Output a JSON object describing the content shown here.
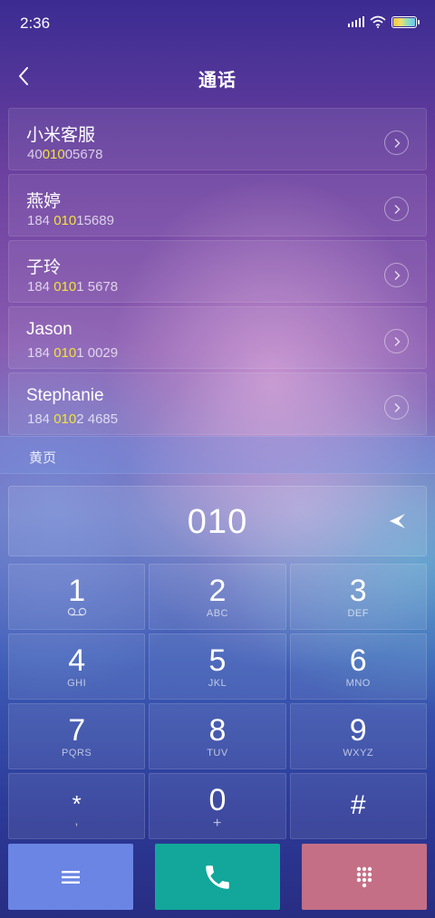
{
  "status_bar": {
    "time": "2:36"
  },
  "header": {
    "title": "通话"
  },
  "contacts": [
    {
      "name": "小米客服",
      "number_pre": "40",
      "number_match": "010",
      "number_post": "05678"
    },
    {
      "name": "燕婷",
      "number_pre": "184 ",
      "number_match": "010",
      "number_post": "15689"
    },
    {
      "name": "子玲",
      "number_pre": "184 ",
      "number_match": "010",
      "number_post": "1 5678"
    },
    {
      "name": "Jason",
      "number_pre": "184 ",
      "number_match": "010",
      "number_post": "1 0029"
    },
    {
      "name": "Stephanie",
      "number_pre": "184 ",
      "number_match": "010",
      "number_post": "2 4685"
    }
  ],
  "yellow_pages": {
    "label": "黄页"
  },
  "dial": {
    "number": "010"
  },
  "keypad": {
    "keys": [
      {
        "digit": "1",
        "letters": "",
        "icon": "voicemail-icon"
      },
      {
        "digit": "2",
        "letters": "ABC"
      },
      {
        "digit": "3",
        "letters": "DEF"
      },
      {
        "digit": "4",
        "letters": "GHI"
      },
      {
        "digit": "5",
        "letters": "JKL"
      },
      {
        "digit": "6",
        "letters": "MNO"
      },
      {
        "digit": "7",
        "letters": "PQRS"
      },
      {
        "digit": "8",
        "letters": "TUV"
      },
      {
        "digit": "9",
        "letters": "WXYZ"
      },
      {
        "digit": "*",
        "letters": ","
      },
      {
        "digit": "0",
        "letters": "+"
      },
      {
        "digit": "#",
        "letters": ""
      }
    ]
  },
  "actions": {
    "menu_icon": "menu-icon",
    "call_icon": "phone-icon",
    "keypad_icon": "dialpad-icon"
  },
  "colors": {
    "highlight": "#f3e33c",
    "menu_button": "#6b85e4",
    "call_button": "#12a79a",
    "keypad_button": "#c46f86"
  }
}
